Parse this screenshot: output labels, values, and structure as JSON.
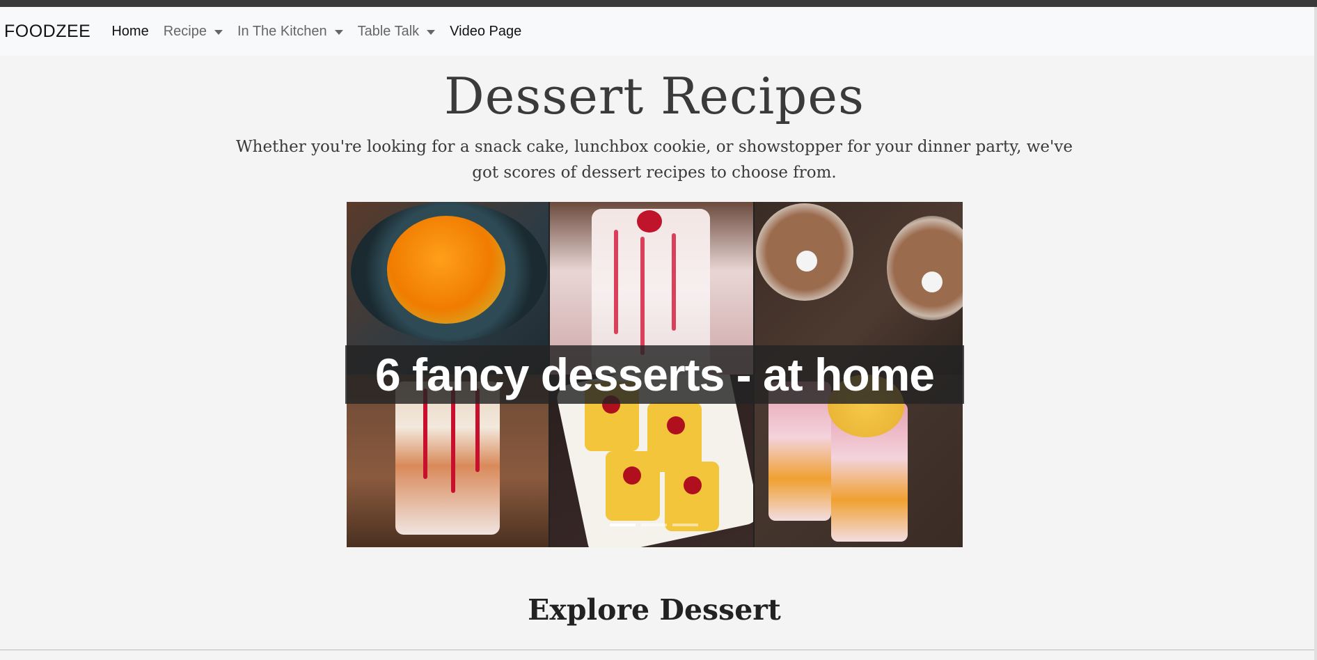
{
  "navbar": {
    "brand": "FOODZEE",
    "items": [
      {
        "label": "Home",
        "dropdown": false
      },
      {
        "label": "Recipe",
        "dropdown": true
      },
      {
        "label": "In The Kitchen",
        "dropdown": true
      },
      {
        "label": "Table Talk",
        "dropdown": true
      },
      {
        "label": "Video Page",
        "dropdown": false
      }
    ]
  },
  "hero": {
    "title": "Dessert Recipes",
    "intro": "Whether you're looking for a snack cake, lunchbox cookie, or showstopper for your dinner party, we've got scores of dessert recipes to choose from."
  },
  "carousel": {
    "caption": "6 fancy desserts - at home",
    "slide_count": 3,
    "active_index": 0
  },
  "section": {
    "title": "Explore Dessert"
  }
}
